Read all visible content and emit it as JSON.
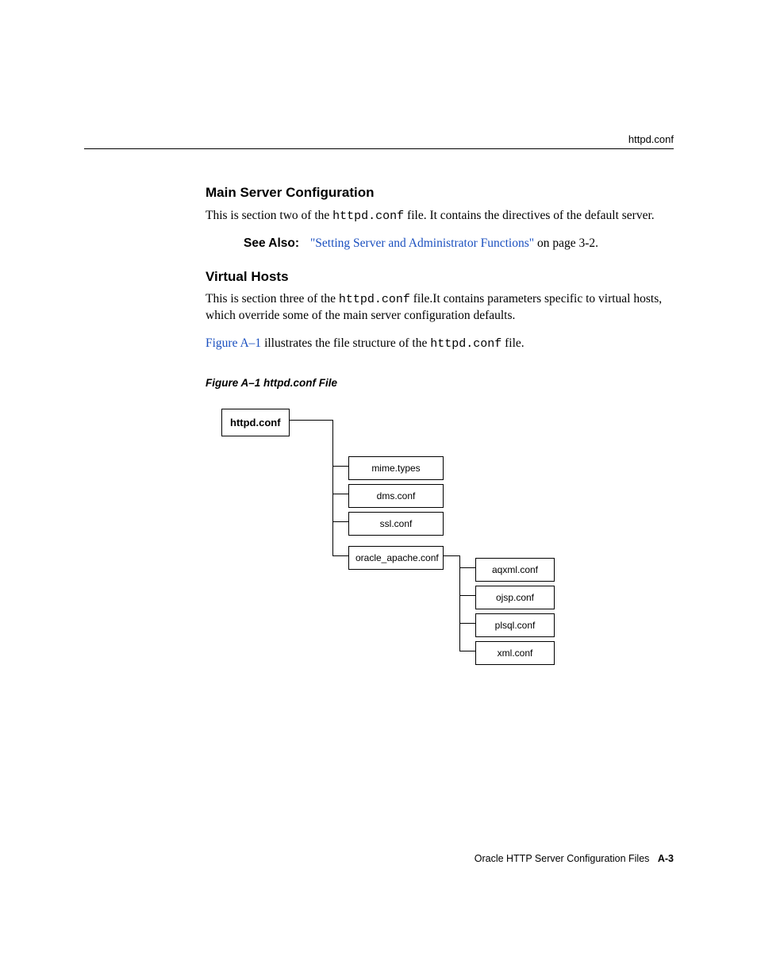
{
  "header": {
    "running_head": "httpd.conf"
  },
  "sections": {
    "main_server": {
      "heading": "Main Server Configuration",
      "para_pre": "This is section two of the ",
      "para_code": "httpd.conf",
      "para_post": " file. It contains the directives of the default server.",
      "see_also_label": "See Also:",
      "see_also_link": "\"Setting Server and Administrator Functions\"",
      "see_also_tail": " on page 3-2."
    },
    "virtual_hosts": {
      "heading": "Virtual Hosts",
      "para1_pre": "This is section three of the ",
      "para1_code": "httpd.conf",
      "para1_post": " file.It contains parameters specific to virtual hosts, which override some of the main server configuration defaults.",
      "para2_link": "Figure A–1",
      "para2_mid": " illustrates the file structure of the ",
      "para2_code": "httpd.conf",
      "para2_post": " file."
    }
  },
  "figure": {
    "caption": "Figure A–1    httpd.conf File",
    "root": "httpd.conf",
    "level1": {
      "0": "mime.types",
      "1": "dms.conf",
      "2": "ssl.conf",
      "3": "oracle_apache.conf"
    },
    "level2": {
      "0": "aqxml.conf",
      "1": "ojsp.conf",
      "2": "plsql.conf",
      "3": "xml.conf"
    }
  },
  "footer": {
    "text": "Oracle HTTP Server Configuration Files",
    "pagenum": "A-3"
  }
}
